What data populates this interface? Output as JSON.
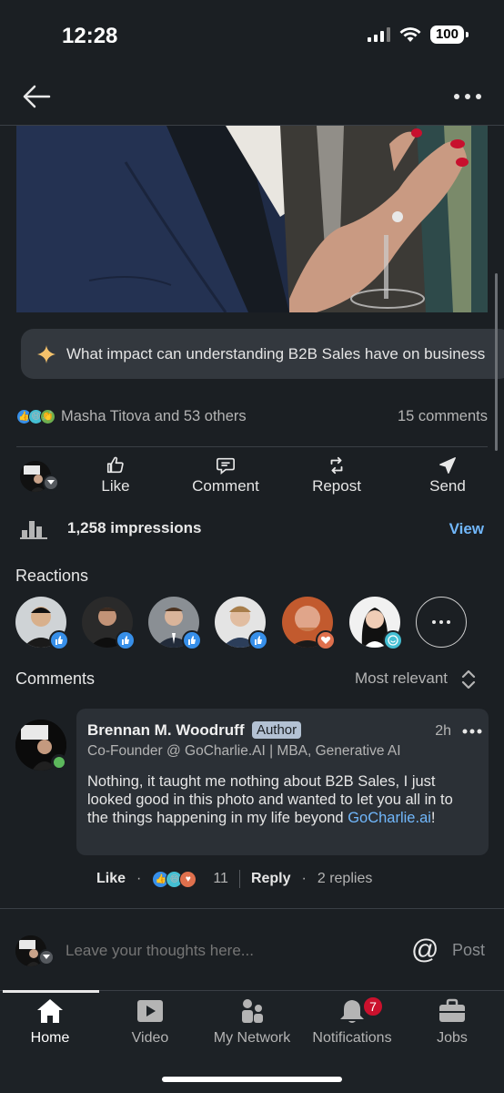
{
  "status_bar": {
    "time": "12:28",
    "battery": "100"
  },
  "post": {
    "ai_prompt": "What impact can understanding B2B Sales have on business",
    "reactions_summary": "Masha Titova and 53 others",
    "comments_count": "15 comments",
    "actions": {
      "like": "Like",
      "comment": "Comment",
      "repost": "Repost",
      "send": "Send"
    },
    "impressions": "1,258 impressions",
    "view_label": "View"
  },
  "reactions": {
    "title": "Reactions",
    "people": [
      {
        "reaction": "like"
      },
      {
        "reaction": "like"
      },
      {
        "reaction": "like"
      },
      {
        "reaction": "like"
      },
      {
        "reaction": "love"
      },
      {
        "reaction": "funny"
      }
    ]
  },
  "comments": {
    "title": "Comments",
    "sort": "Most relevant",
    "items": [
      {
        "name": "Brennan M. Woodruff",
        "badge": "Author",
        "time": "2h",
        "headline": "Co-Founder @ GoCharlie.AI | MBA, Generative AI",
        "body": "Nothing, it taught me nothing about B2B Sales, I just looked good in this photo and wanted to let you all in to the things happening in my life beyond ",
        "link": "GoCharlie.ai",
        "body_end": "!",
        "like": "Like",
        "reaction_count": "11",
        "reply": "Reply",
        "replies": "2 replies"
      }
    ]
  },
  "compose": {
    "placeholder": "Leave your thoughts here...",
    "post": "Post"
  },
  "tabs": [
    {
      "label": "Home"
    },
    {
      "label": "Video"
    },
    {
      "label": "My Network"
    },
    {
      "label": "Notifications",
      "badge": "7"
    },
    {
      "label": "Jobs"
    }
  ],
  "colors": {
    "background": "#1b1f23",
    "link": "#71b7fb",
    "like": "#378fe9",
    "love": "#df704d",
    "funny": "#44bfd3",
    "online": "#5cb85c",
    "badge": "#cb112d"
  }
}
